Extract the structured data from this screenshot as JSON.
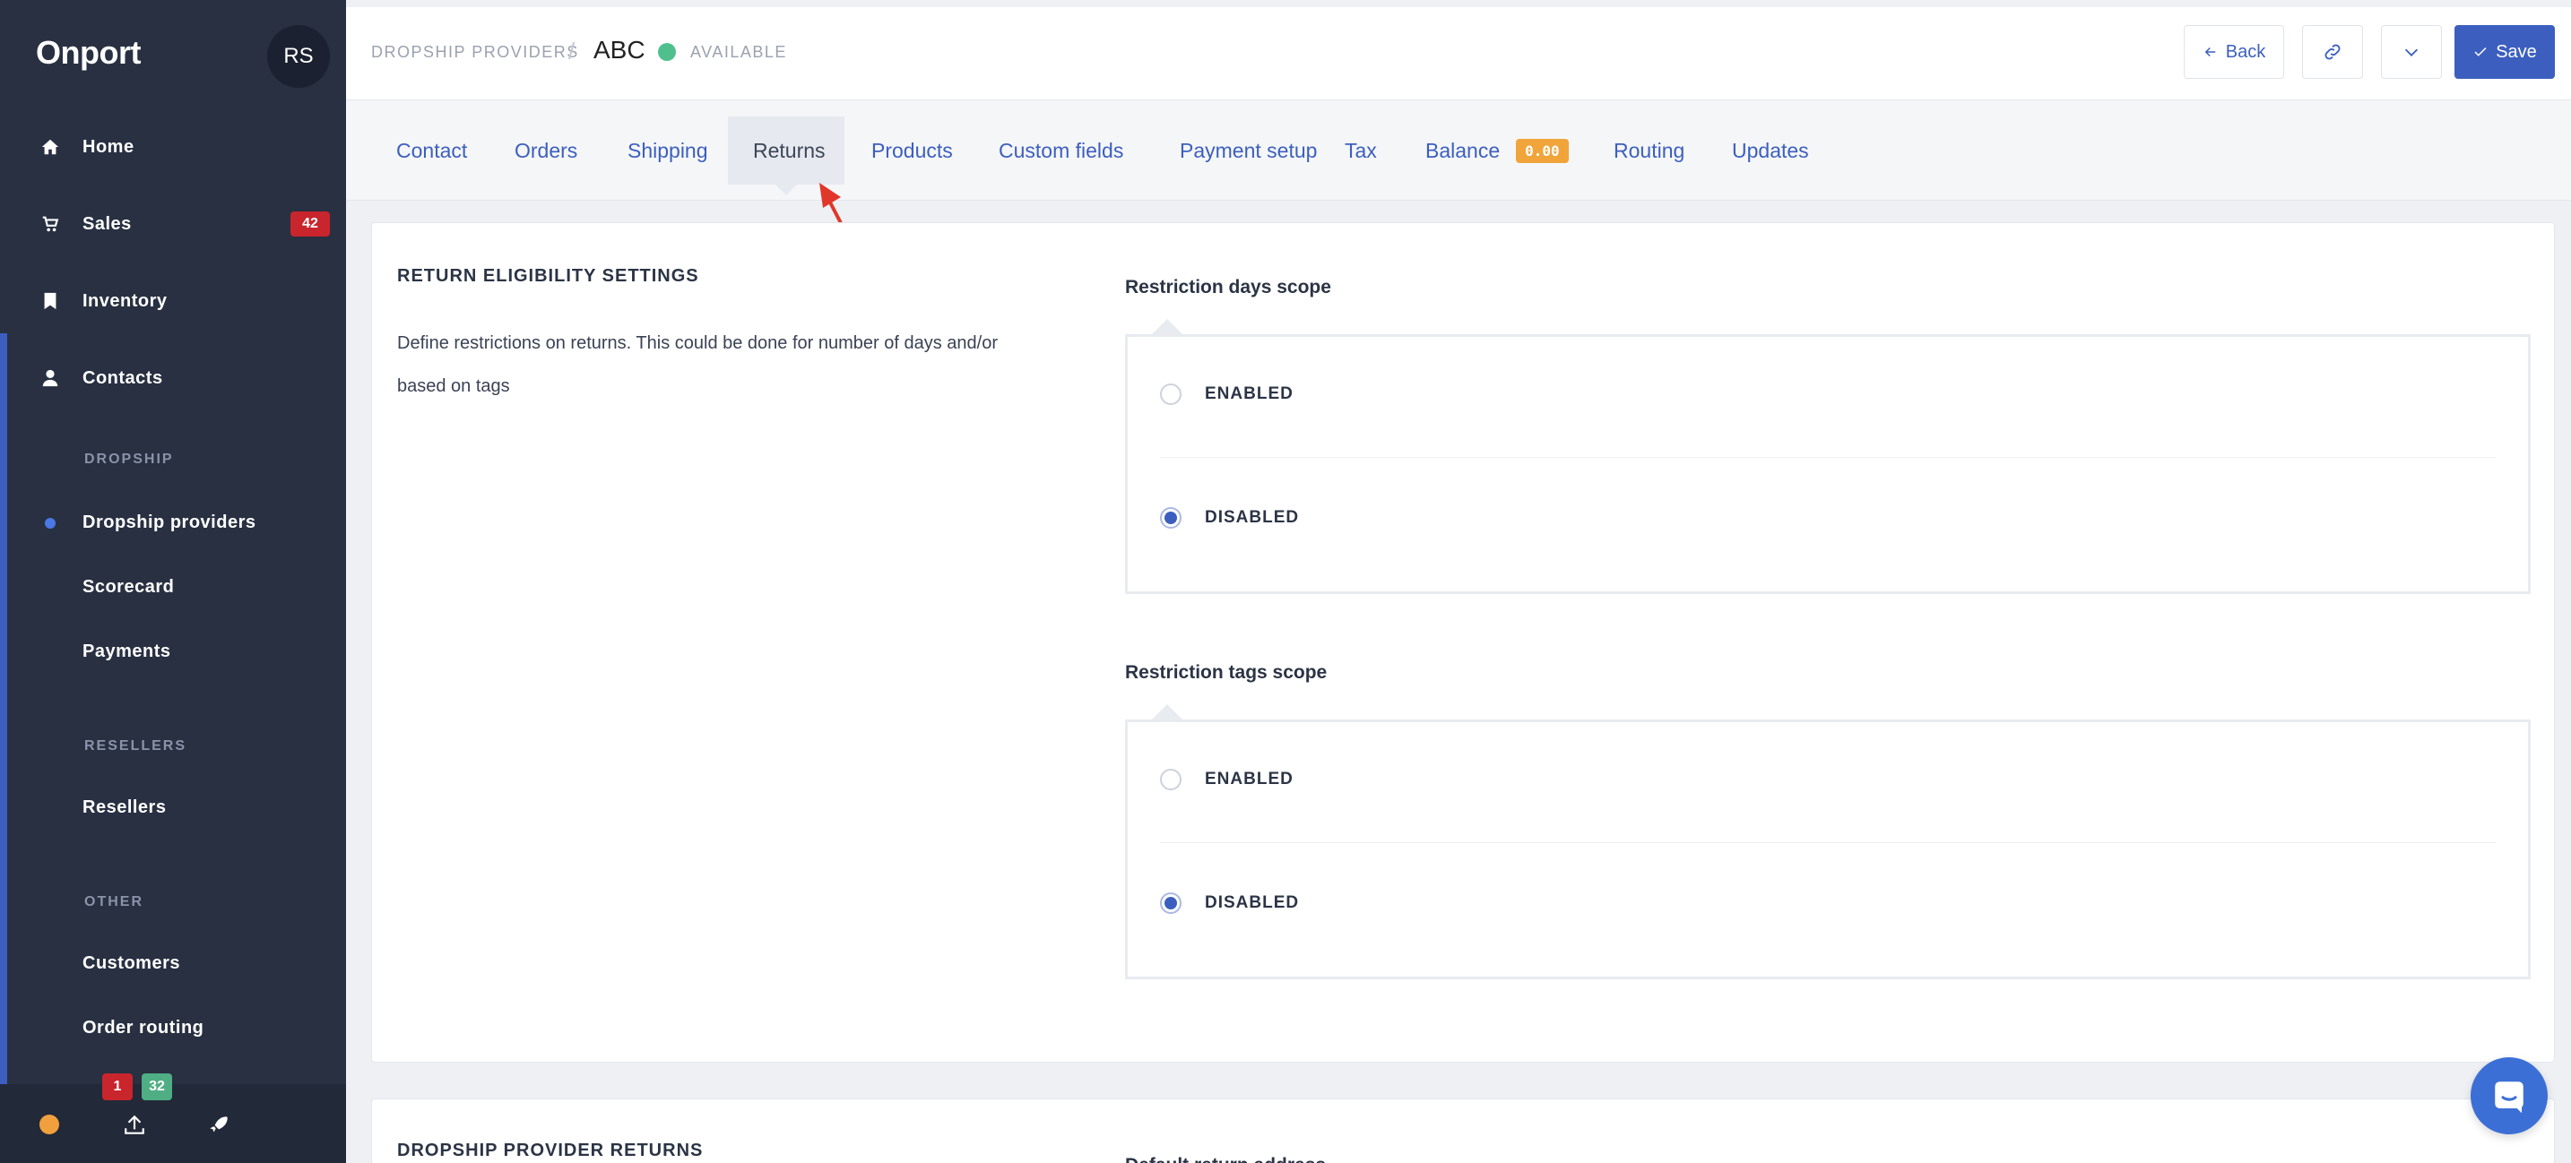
{
  "app": {
    "brand": "Onport",
    "user_initials": "RS"
  },
  "sidebar": {
    "nav": [
      {
        "label": "Home",
        "icon": "home-icon"
      },
      {
        "label": "Sales",
        "icon": "cart-icon",
        "badge": "42"
      },
      {
        "label": "Inventory",
        "icon": "bookmark-icon"
      },
      {
        "label": "Contacts",
        "icon": "person-icon"
      }
    ],
    "sections": [
      {
        "heading": "DROPSHIP",
        "items": [
          "Dropship providers",
          "Scorecard",
          "Payments"
        ]
      },
      {
        "heading": "RESELLERS",
        "items": [
          "Resellers"
        ]
      },
      {
        "heading": "OTHER",
        "items": [
          "Customers",
          "Order routing"
        ]
      }
    ],
    "active_item": "Dropship providers",
    "bottom": {
      "red_count": "1",
      "green_count": "32"
    }
  },
  "header": {
    "breadcrumb": "DROPSHIP PROVIDERS",
    "separator": "/",
    "title": "ABC",
    "status": "AVAILABLE",
    "back_label": "Back",
    "save_label": "Save"
  },
  "tabs": [
    {
      "label": "Contact"
    },
    {
      "label": "Orders"
    },
    {
      "label": "Shipping"
    },
    {
      "label": "Returns",
      "active": true
    },
    {
      "label": "Products"
    },
    {
      "label": "Custom fields"
    },
    {
      "label": "Payment setup"
    },
    {
      "label": "Tax"
    },
    {
      "label": "Balance",
      "badge": "0.00"
    },
    {
      "label": "Routing"
    },
    {
      "label": "Updates"
    }
  ],
  "return_eligibility": {
    "title": "RETURN ELIGIBILITY SETTINGS",
    "description": "Define restrictions on returns. This could be done for number of days and/or based on tags",
    "days_scope": {
      "label": "Restriction days scope",
      "options": [
        "ENABLED",
        "DISABLED"
      ],
      "selected": "DISABLED"
    },
    "tags_scope": {
      "label": "Restriction tags scope",
      "options": [
        "ENABLED",
        "DISABLED"
      ],
      "selected": "DISABLED"
    }
  },
  "provider_returns": {
    "title": "DROPSHIP PROVIDER RETURNS",
    "address_label": "Default return address"
  },
  "colors": {
    "accent": "#3c5fbf",
    "sidebar": "#283042",
    "badge_red": "#c9252d",
    "badge_green": "#4fae84",
    "balance_badge": "#f0a43a",
    "annotation_arrow": "#e0372a"
  }
}
